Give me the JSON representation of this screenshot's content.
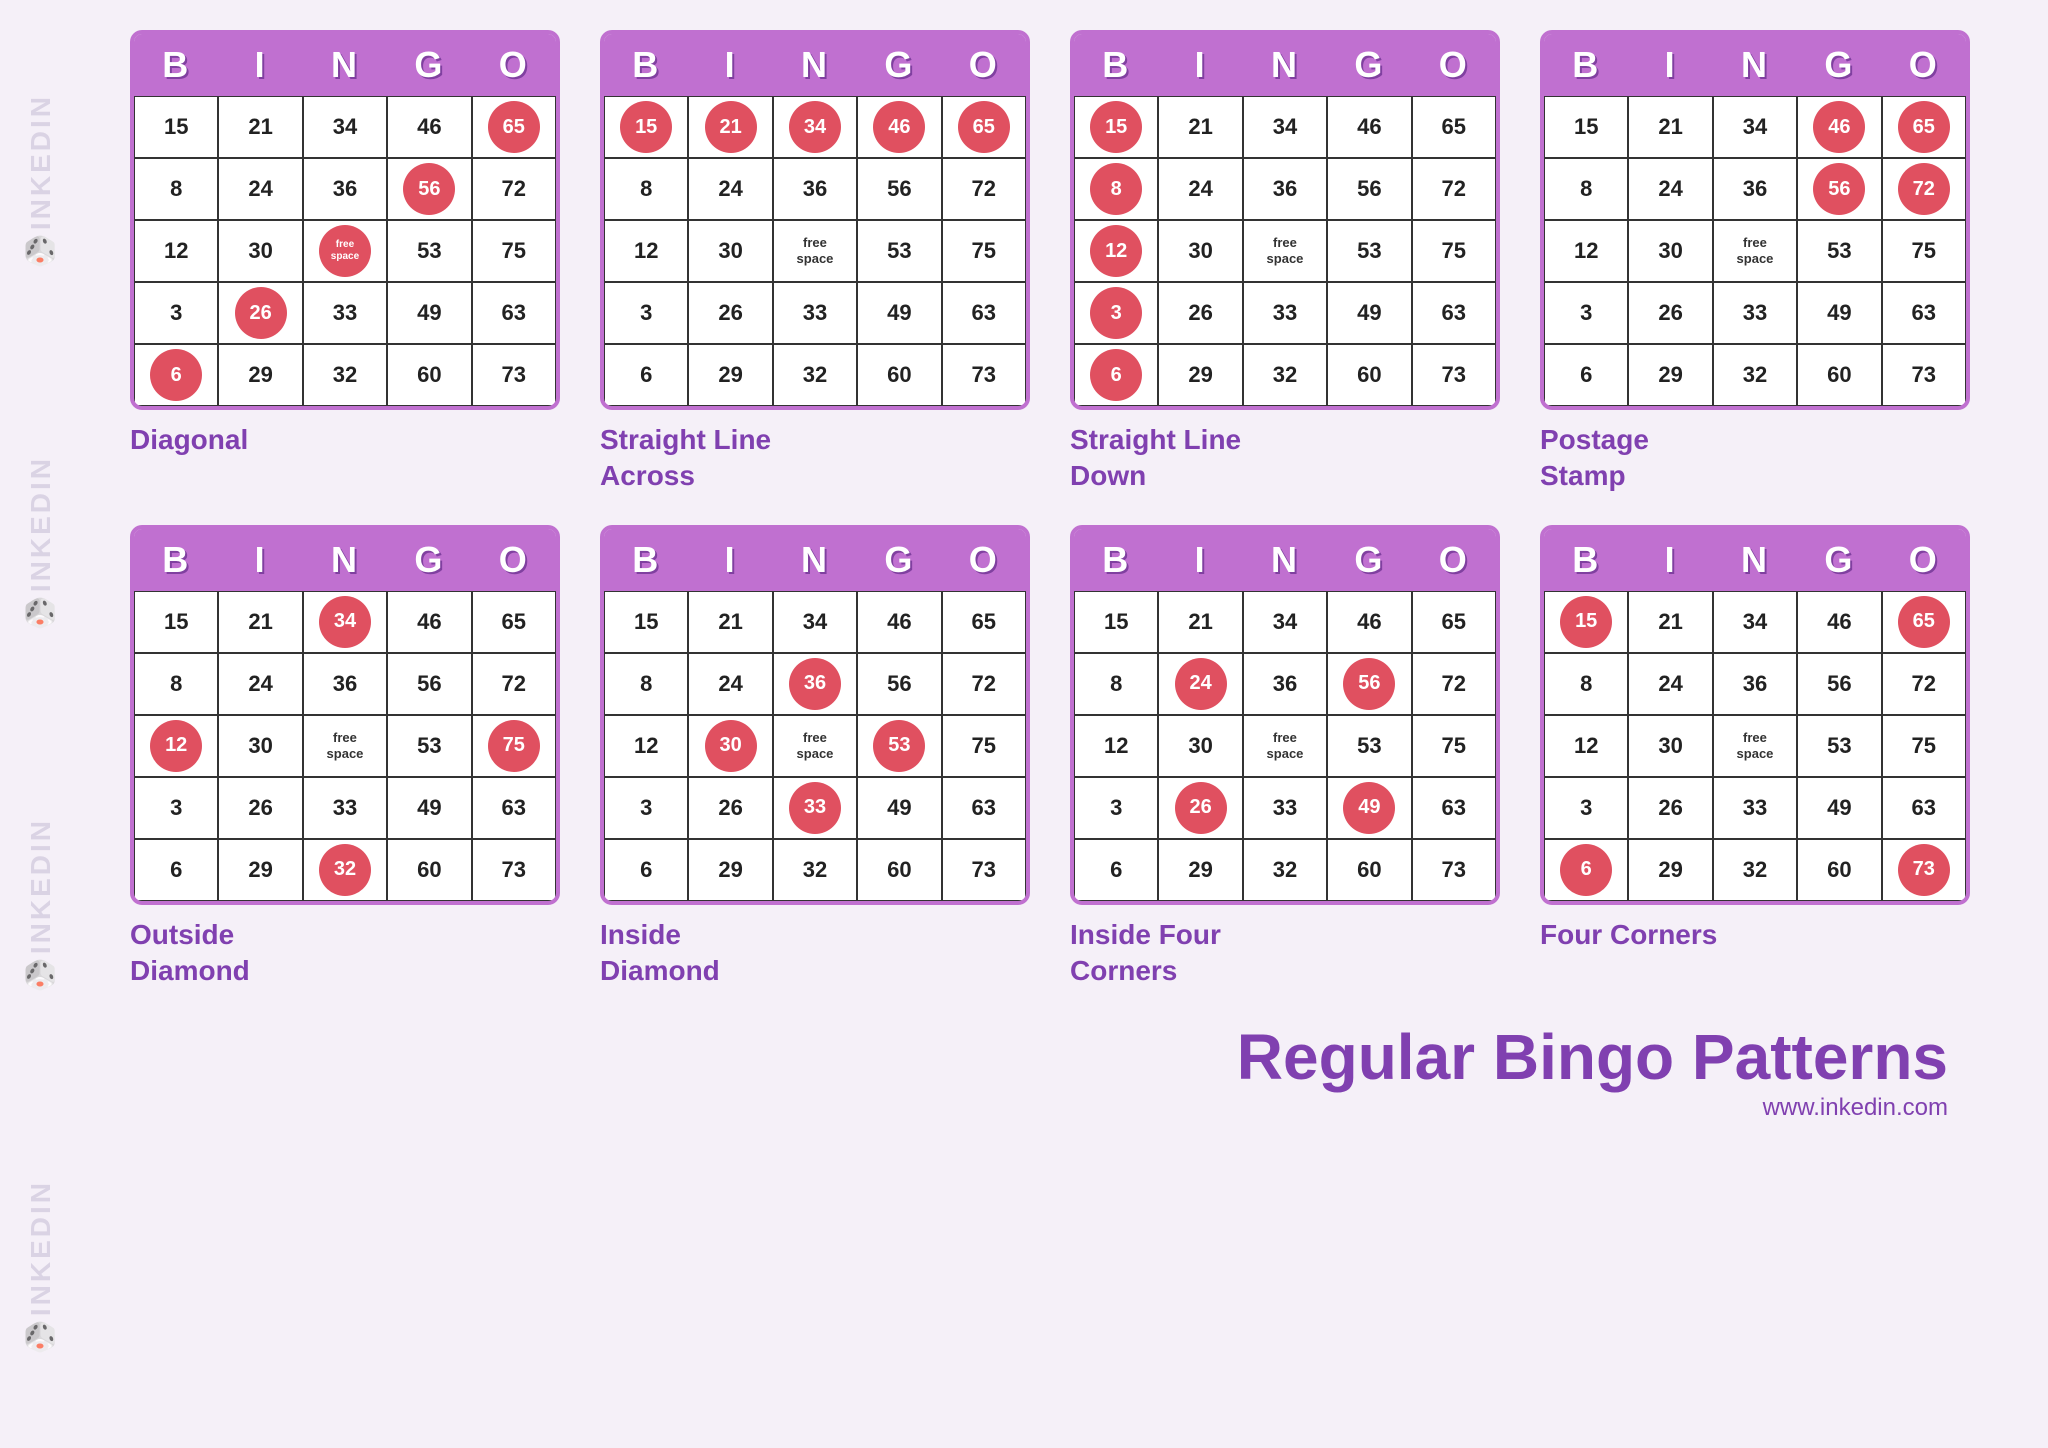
{
  "watermark": {
    "texts": [
      "🎲INKEDIN",
      "🎲INKEDIN",
      "🎲INKEDIN",
      "🎲INKEDIN"
    ]
  },
  "header_letters": [
    "B",
    "I",
    "N",
    "G",
    "O"
  ],
  "cards": [
    {
      "id": "diagonal",
      "label": "Diagonal",
      "rows": [
        [
          {
            "val": "15",
            "marked": false
          },
          {
            "val": "21",
            "marked": false
          },
          {
            "val": "34",
            "marked": false
          },
          {
            "val": "46",
            "marked": false
          },
          {
            "val": "65",
            "marked": true
          }
        ],
        [
          {
            "val": "8",
            "marked": false
          },
          {
            "val": "24",
            "marked": false
          },
          {
            "val": "36",
            "marked": false
          },
          {
            "val": "56",
            "marked": true
          },
          {
            "val": "72",
            "marked": false
          }
        ],
        [
          {
            "val": "12",
            "marked": false
          },
          {
            "val": "30",
            "marked": false
          },
          {
            "val": "free space",
            "marked": true,
            "free": true
          },
          {
            "val": "53",
            "marked": false
          },
          {
            "val": "75",
            "marked": false
          }
        ],
        [
          {
            "val": "3",
            "marked": false
          },
          {
            "val": "26",
            "marked": true
          },
          {
            "val": "33",
            "marked": false
          },
          {
            "val": "49",
            "marked": false
          },
          {
            "val": "63",
            "marked": false
          }
        ],
        [
          {
            "val": "6",
            "marked": true
          },
          {
            "val": "29",
            "marked": false
          },
          {
            "val": "32",
            "marked": false
          },
          {
            "val": "60",
            "marked": false
          },
          {
            "val": "73",
            "marked": false
          }
        ]
      ]
    },
    {
      "id": "straight-line-across",
      "label": "Straight Line\nAcross",
      "rows": [
        [
          {
            "val": "15",
            "marked": true
          },
          {
            "val": "21",
            "marked": true
          },
          {
            "val": "34",
            "marked": true
          },
          {
            "val": "46",
            "marked": true
          },
          {
            "val": "65",
            "marked": true
          }
        ],
        [
          {
            "val": "8",
            "marked": false
          },
          {
            "val": "24",
            "marked": false
          },
          {
            "val": "36",
            "marked": false
          },
          {
            "val": "56",
            "marked": false
          },
          {
            "val": "72",
            "marked": false
          }
        ],
        [
          {
            "val": "12",
            "marked": false
          },
          {
            "val": "30",
            "marked": false
          },
          {
            "val": "free space",
            "marked": false,
            "free": true
          },
          {
            "val": "53",
            "marked": false
          },
          {
            "val": "75",
            "marked": false
          }
        ],
        [
          {
            "val": "3",
            "marked": false
          },
          {
            "val": "26",
            "marked": false
          },
          {
            "val": "33",
            "marked": false
          },
          {
            "val": "49",
            "marked": false
          },
          {
            "val": "63",
            "marked": false
          }
        ],
        [
          {
            "val": "6",
            "marked": false
          },
          {
            "val": "29",
            "marked": false
          },
          {
            "val": "32",
            "marked": false
          },
          {
            "val": "60",
            "marked": false
          },
          {
            "val": "73",
            "marked": false
          }
        ]
      ]
    },
    {
      "id": "straight-line-down",
      "label": "Straight Line\nDown",
      "rows": [
        [
          {
            "val": "15",
            "marked": true
          },
          {
            "val": "21",
            "marked": false
          },
          {
            "val": "34",
            "marked": false
          },
          {
            "val": "46",
            "marked": false
          },
          {
            "val": "65",
            "marked": false
          }
        ],
        [
          {
            "val": "8",
            "marked": true
          },
          {
            "val": "24",
            "marked": false
          },
          {
            "val": "36",
            "marked": false
          },
          {
            "val": "56",
            "marked": false
          },
          {
            "val": "72",
            "marked": false
          }
        ],
        [
          {
            "val": "12",
            "marked": true
          },
          {
            "val": "30",
            "marked": false
          },
          {
            "val": "free space",
            "marked": false,
            "free": true
          },
          {
            "val": "53",
            "marked": false
          },
          {
            "val": "75",
            "marked": false
          }
        ],
        [
          {
            "val": "3",
            "marked": true
          },
          {
            "val": "26",
            "marked": false
          },
          {
            "val": "33",
            "marked": false
          },
          {
            "val": "49",
            "marked": false
          },
          {
            "val": "63",
            "marked": false
          }
        ],
        [
          {
            "val": "6",
            "marked": true
          },
          {
            "val": "29",
            "marked": false
          },
          {
            "val": "32",
            "marked": false
          },
          {
            "val": "60",
            "marked": false
          },
          {
            "val": "73",
            "marked": false
          }
        ]
      ]
    },
    {
      "id": "postage-stamp",
      "label": "Postage\nStamp",
      "rows": [
        [
          {
            "val": "15",
            "marked": false
          },
          {
            "val": "21",
            "marked": false
          },
          {
            "val": "34",
            "marked": false
          },
          {
            "val": "46",
            "marked": true
          },
          {
            "val": "65",
            "marked": true
          }
        ],
        [
          {
            "val": "8",
            "marked": false
          },
          {
            "val": "24",
            "marked": false
          },
          {
            "val": "36",
            "marked": false
          },
          {
            "val": "56",
            "marked": true
          },
          {
            "val": "72",
            "marked": true
          }
        ],
        [
          {
            "val": "12",
            "marked": false
          },
          {
            "val": "30",
            "marked": false
          },
          {
            "val": "free space",
            "marked": false,
            "free": true
          },
          {
            "val": "53",
            "marked": false
          },
          {
            "val": "75",
            "marked": false
          }
        ],
        [
          {
            "val": "3",
            "marked": false
          },
          {
            "val": "26",
            "marked": false
          },
          {
            "val": "33",
            "marked": false
          },
          {
            "val": "49",
            "marked": false
          },
          {
            "val": "63",
            "marked": false
          }
        ],
        [
          {
            "val": "6",
            "marked": false
          },
          {
            "val": "29",
            "marked": false
          },
          {
            "val": "32",
            "marked": false
          },
          {
            "val": "60",
            "marked": false
          },
          {
            "val": "73",
            "marked": false
          }
        ]
      ]
    },
    {
      "id": "outside-diamond",
      "label": "Outside\nDiamond",
      "rows": [
        [
          {
            "val": "15",
            "marked": false
          },
          {
            "val": "21",
            "marked": false
          },
          {
            "val": "34",
            "marked": true
          },
          {
            "val": "46",
            "marked": false
          },
          {
            "val": "65",
            "marked": false
          }
        ],
        [
          {
            "val": "8",
            "marked": false
          },
          {
            "val": "24",
            "marked": false
          },
          {
            "val": "36",
            "marked": false
          },
          {
            "val": "56",
            "marked": false
          },
          {
            "val": "72",
            "marked": false
          }
        ],
        [
          {
            "val": "12",
            "marked": true
          },
          {
            "val": "30",
            "marked": false
          },
          {
            "val": "free space",
            "marked": false,
            "free": true
          },
          {
            "val": "53",
            "marked": false
          },
          {
            "val": "75",
            "marked": true
          }
        ],
        [
          {
            "val": "3",
            "marked": false
          },
          {
            "val": "26",
            "marked": false
          },
          {
            "val": "33",
            "marked": false
          },
          {
            "val": "49",
            "marked": false
          },
          {
            "val": "63",
            "marked": false
          }
        ],
        [
          {
            "val": "6",
            "marked": false
          },
          {
            "val": "29",
            "marked": false
          },
          {
            "val": "32",
            "marked": true
          },
          {
            "val": "60",
            "marked": false
          },
          {
            "val": "73",
            "marked": false
          }
        ]
      ]
    },
    {
      "id": "inside-diamond",
      "label": "Inside\nDiamond",
      "rows": [
        [
          {
            "val": "15",
            "marked": false
          },
          {
            "val": "21",
            "marked": false
          },
          {
            "val": "34",
            "marked": false
          },
          {
            "val": "46",
            "marked": false
          },
          {
            "val": "65",
            "marked": false
          }
        ],
        [
          {
            "val": "8",
            "marked": false
          },
          {
            "val": "24",
            "marked": false
          },
          {
            "val": "36",
            "marked": true
          },
          {
            "val": "56",
            "marked": false
          },
          {
            "val": "72",
            "marked": false
          }
        ],
        [
          {
            "val": "12",
            "marked": false
          },
          {
            "val": "30",
            "marked": true
          },
          {
            "val": "free space",
            "marked": false,
            "free": true
          },
          {
            "val": "53",
            "marked": true
          },
          {
            "val": "75",
            "marked": false
          }
        ],
        [
          {
            "val": "3",
            "marked": false
          },
          {
            "val": "26",
            "marked": false
          },
          {
            "val": "33",
            "marked": true
          },
          {
            "val": "49",
            "marked": false
          },
          {
            "val": "63",
            "marked": false
          }
        ],
        [
          {
            "val": "6",
            "marked": false
          },
          {
            "val": "29",
            "marked": false
          },
          {
            "val": "32",
            "marked": false
          },
          {
            "val": "60",
            "marked": false
          },
          {
            "val": "73",
            "marked": false
          }
        ]
      ]
    },
    {
      "id": "inside-four-corners",
      "label": "Inside Four\nCorners",
      "rows": [
        [
          {
            "val": "15",
            "marked": false
          },
          {
            "val": "21",
            "marked": false
          },
          {
            "val": "34",
            "marked": false
          },
          {
            "val": "46",
            "marked": false
          },
          {
            "val": "65",
            "marked": false
          }
        ],
        [
          {
            "val": "8",
            "marked": false
          },
          {
            "val": "24",
            "marked": true
          },
          {
            "val": "36",
            "marked": false
          },
          {
            "val": "56",
            "marked": true
          },
          {
            "val": "72",
            "marked": false
          }
        ],
        [
          {
            "val": "12",
            "marked": false
          },
          {
            "val": "30",
            "marked": false
          },
          {
            "val": "free space",
            "marked": false,
            "free": true
          },
          {
            "val": "53",
            "marked": false
          },
          {
            "val": "75",
            "marked": false
          }
        ],
        [
          {
            "val": "3",
            "marked": false
          },
          {
            "val": "26",
            "marked": true
          },
          {
            "val": "33",
            "marked": false
          },
          {
            "val": "49",
            "marked": true
          },
          {
            "val": "63",
            "marked": false
          }
        ],
        [
          {
            "val": "6",
            "marked": false
          },
          {
            "val": "29",
            "marked": false
          },
          {
            "val": "32",
            "marked": false
          },
          {
            "val": "60",
            "marked": false
          },
          {
            "val": "73",
            "marked": false
          }
        ]
      ]
    },
    {
      "id": "four-corners",
      "label": "Four Corners",
      "rows": [
        [
          {
            "val": "15",
            "marked": true
          },
          {
            "val": "21",
            "marked": false
          },
          {
            "val": "34",
            "marked": false
          },
          {
            "val": "46",
            "marked": false
          },
          {
            "val": "65",
            "marked": true
          }
        ],
        [
          {
            "val": "8",
            "marked": false
          },
          {
            "val": "24",
            "marked": false
          },
          {
            "val": "36",
            "marked": false
          },
          {
            "val": "56",
            "marked": false
          },
          {
            "val": "72",
            "marked": false
          }
        ],
        [
          {
            "val": "12",
            "marked": false
          },
          {
            "val": "30",
            "marked": false
          },
          {
            "val": "free space",
            "marked": false,
            "free": true
          },
          {
            "val": "53",
            "marked": false
          },
          {
            "val": "75",
            "marked": false
          }
        ],
        [
          {
            "val": "3",
            "marked": false
          },
          {
            "val": "26",
            "marked": false
          },
          {
            "val": "33",
            "marked": false
          },
          {
            "val": "49",
            "marked": false
          },
          {
            "val": "63",
            "marked": false
          }
        ],
        [
          {
            "val": "6",
            "marked": true
          },
          {
            "val": "29",
            "marked": false
          },
          {
            "val": "32",
            "marked": false
          },
          {
            "val": "60",
            "marked": false
          },
          {
            "val": "73",
            "marked": true
          }
        ]
      ]
    }
  ],
  "main_title": "Regular Bingo Patterns",
  "website": "www.inkedin.com"
}
